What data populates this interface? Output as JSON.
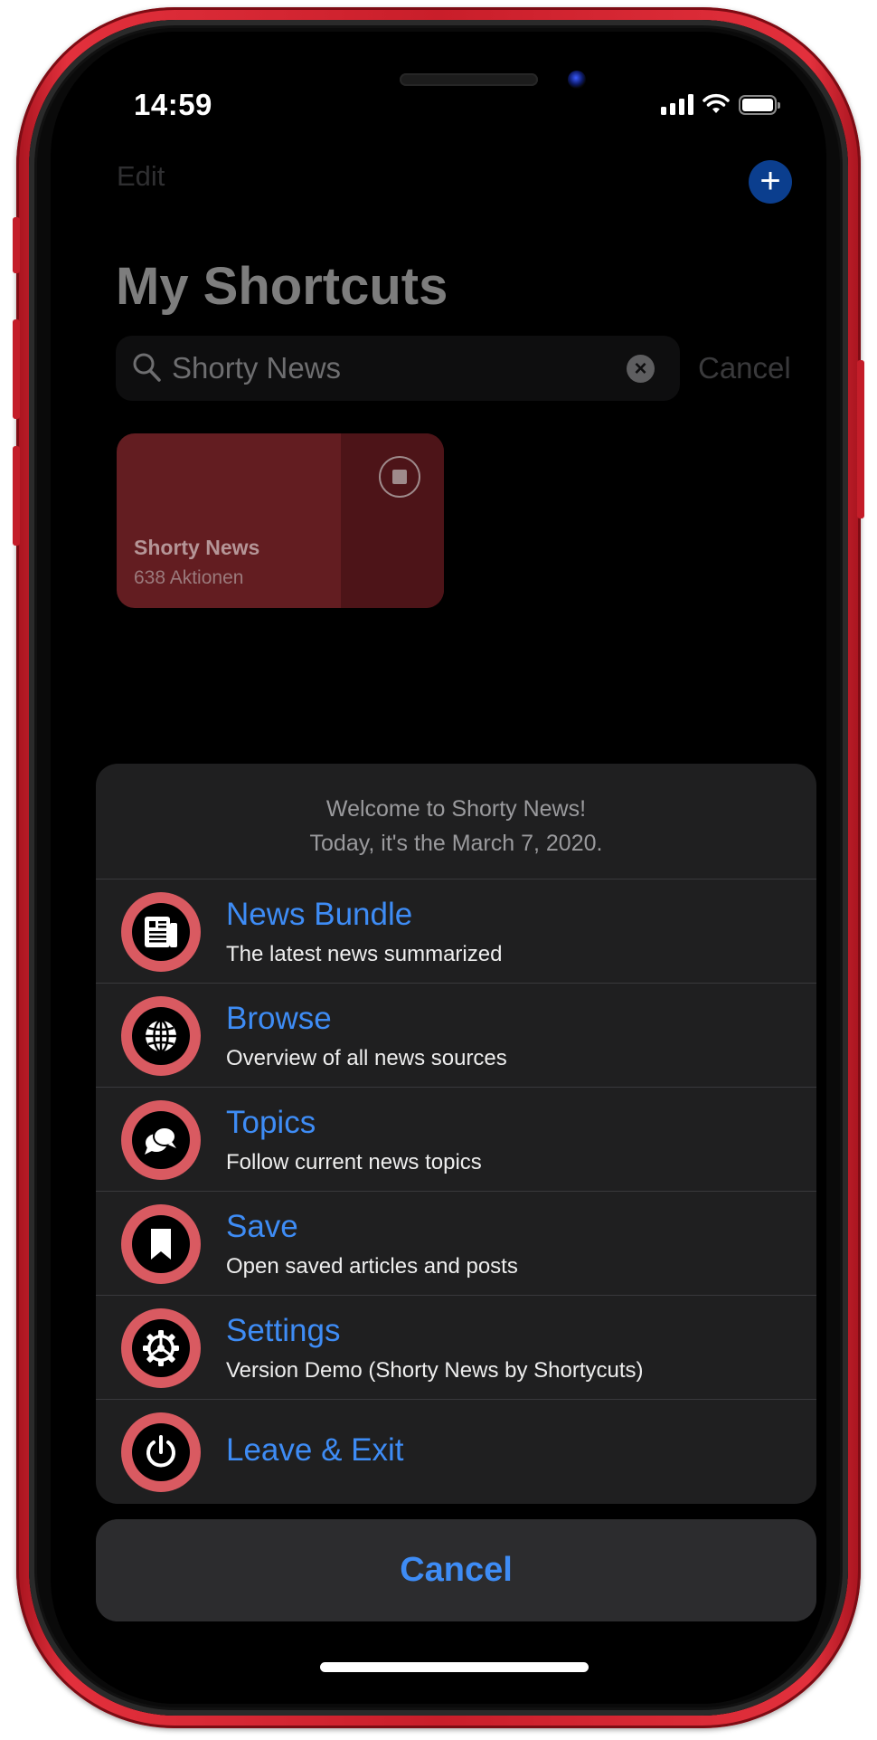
{
  "status_bar": {
    "time": "14:59"
  },
  "nav": {
    "edit_label": "Edit",
    "add_symbol": "+",
    "title": "My Shortcuts"
  },
  "search": {
    "value": "Shorty News",
    "clear_symbol": "×",
    "cancel_label": "Cancel"
  },
  "shortcut_tile": {
    "name": "Shorty News",
    "subtitle": "638 Aktionen",
    "color": "#631d21"
  },
  "sheet": {
    "message_line1": "Welcome to Shorty News!",
    "message_line2": "Today, it's the March 7, 2020.",
    "items": [
      {
        "label": "News Bundle",
        "subtitle": "The latest news summarized",
        "icon": "newspaper-icon"
      },
      {
        "label": "Browse",
        "subtitle": "Overview of all news sources",
        "icon": "globe-icon"
      },
      {
        "label": "Topics",
        "subtitle": "Follow current news topics",
        "icon": "speech-bubbles-icon"
      },
      {
        "label": "Save",
        "subtitle": "Open saved articles and posts",
        "icon": "bookmark-icon"
      },
      {
        "label": "Settings",
        "subtitle": "Version Demo (Shorty News by Shortycuts)",
        "icon": "gear-icon"
      },
      {
        "label": "Leave & Exit",
        "icon": "power-icon"
      }
    ],
    "cancel_label": "Cancel",
    "accent_color": "#3e8cf5",
    "icon_ring_color": "#d95a61"
  }
}
